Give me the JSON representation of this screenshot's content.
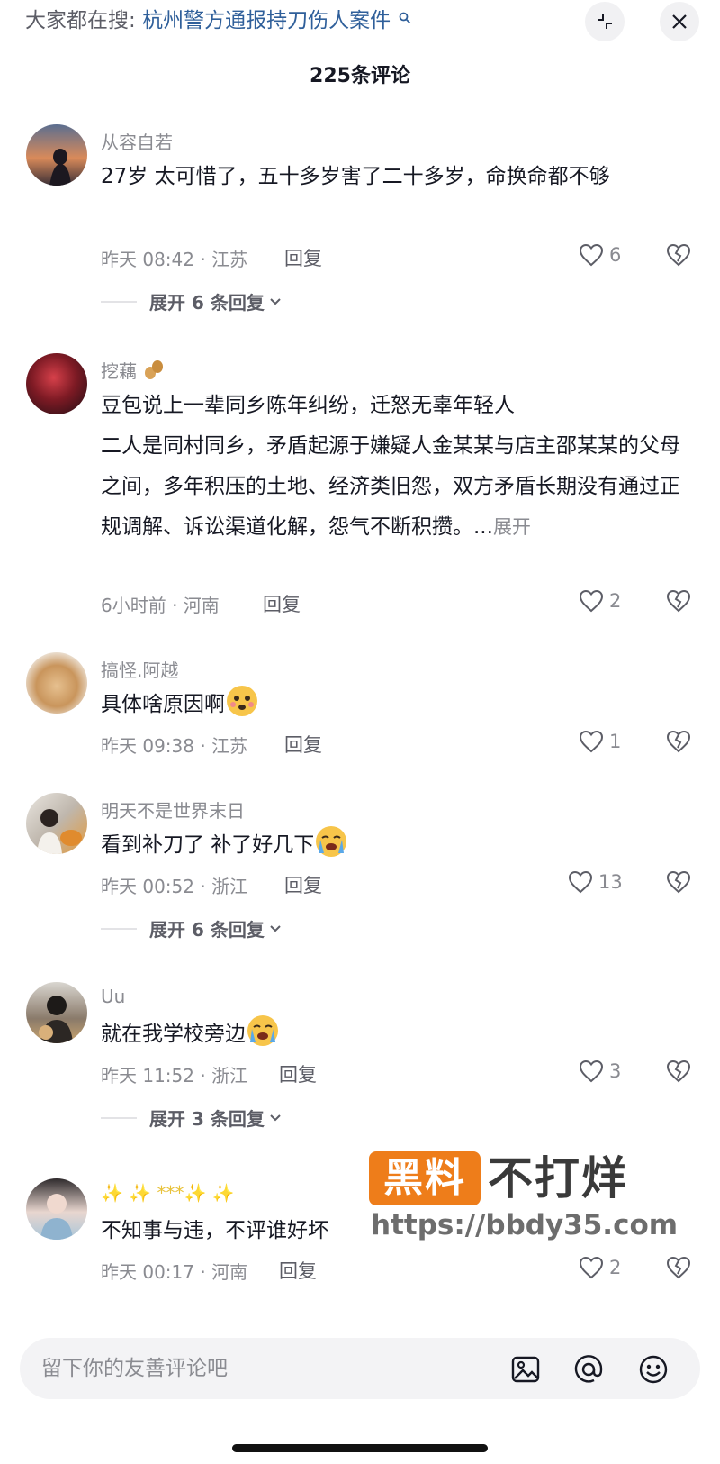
{
  "search_bar": {
    "prefix": "大家都在搜:",
    "query": "杭州警方通报持刀伤人案件",
    "search_icon": "magnifier-icon",
    "collapse_icon": "collapse-arrows-icon",
    "close_icon": "close-icon"
  },
  "comment_count_title": "225条评论",
  "comments": [
    {
      "username": "从容自若",
      "text": "27岁 太可惜了，五十多岁害了二十多岁，命换命都不够",
      "time_location": "昨天 08:42 · 江苏",
      "reply_label": "回复",
      "like_count": "6",
      "expand_label": "展开 6 条回复"
    },
    {
      "username": "挖藕",
      "username_emoji": "peanut-emoji",
      "text_line1": "豆包说上一辈同乡陈年纠纷，迁怒无辜年轻人",
      "text_line2": "二人是同村同乡，矛盾起源于嫌疑人金某某与店主邵某某的父母之间，多年积压的土地、经济类旧怨，双方矛盾长期没有通过正规调解、诉讼渠道化解，怨气不断积攒。...",
      "more_label": "展开",
      "time_location": "6小时前 · 河南",
      "reply_label": "回复",
      "like_count": "2"
    },
    {
      "username": "搞怪.阿越",
      "text": "具体啥原因啊",
      "text_emoji": "dizzy-face-emoji",
      "time_location": "昨天 09:38 · 江苏",
      "reply_label": "回复",
      "like_count": "1"
    },
    {
      "username": "明天不是世界末日",
      "text": "看到补刀了 补了好几下",
      "text_emoji": "crying-face-emoji",
      "time_location": "昨天 00:52 · 浙江",
      "reply_label": "回复",
      "like_count": "13",
      "expand_label": "展开 6 条回复"
    },
    {
      "username": "Uu",
      "text": "就在我学校旁边",
      "text_emoji": "crying-face-emoji",
      "time_location": "昨天 11:52 · 浙江",
      "reply_label": "回复",
      "like_count": "3",
      "expand_label": "展开 3 条回复"
    },
    {
      "username": "✨ ✨ ***✨ ✨",
      "text": "不知事与违，不评谁好坏",
      "time_location": "昨天 00:17 · 河南",
      "reply_label": "回复",
      "like_count": "2"
    }
  ],
  "watermark": {
    "badge_text": "黑料",
    "title": "不打烊",
    "url": "https://bbdy35.com"
  },
  "input_bar": {
    "placeholder": "留下你的友善评论吧",
    "icons": [
      "image-icon",
      "at-mention-icon",
      "emoji-icon"
    ]
  },
  "colors": {
    "accent_link": "#2f5f9a",
    "meta_gray": "#8a8b91",
    "watermark_orange": "#ee7d1a"
  }
}
